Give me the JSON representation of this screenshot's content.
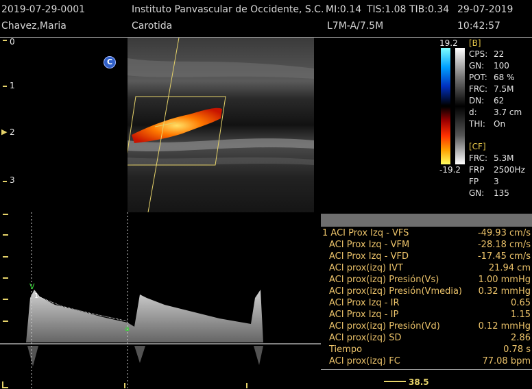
{
  "header": {
    "exam_id": "2019-07-29-0001",
    "patient": "Chavez,Maria",
    "institution": "Instituto Panvascular de Occidente, S.C.",
    "mi": "MI:0.14",
    "tis": "TIS:1.08",
    "tib": "TIB:0.34",
    "date": "29-07-2019",
    "study": "Carotida",
    "probe": "L7M-A/7.5M",
    "time": "10:42:57"
  },
  "depth_scale": [
    "0",
    "1",
    "2",
    "3"
  ],
  "focus_marker": "▶",
  "mode_marker": "C",
  "colorbar": {
    "top_value": "19.2",
    "bottom_value": "-19.2"
  },
  "b_params": {
    "section": "[B]",
    "items": [
      {
        "k": "CPS:",
        "v": "22"
      },
      {
        "k": "GN:",
        "v": "100"
      },
      {
        "k": "POT:",
        "v": "68 %"
      },
      {
        "k": "FRC:",
        "v": "7.5M"
      },
      {
        "k": "DN:",
        "v": "62"
      },
      {
        "k": "d:",
        "v": "3.7 cm"
      },
      {
        "k": "THI:",
        "v": "On"
      }
    ]
  },
  "cf_params": {
    "section": "[CF]",
    "items": [
      {
        "k": "FRC:",
        "v": "5.3M"
      },
      {
        "k": "FRP",
        "v": "2500Hz"
      },
      {
        "k": "FP",
        "v": "3"
      },
      {
        "k": "GN:",
        "v": "135"
      }
    ]
  },
  "measurements": [
    {
      "label": "1 ACI Prox Izq - VFS",
      "value": "-49.93 cm/s"
    },
    {
      "label": "   ACI Prox Izq - VFM",
      "value": "-28.18 cm/s"
    },
    {
      "label": "   ACI Prox Izq - VFD",
      "value": "-17.45 cm/s"
    },
    {
      "label": "   ACI prox(izq) IVT",
      "value": "21.94 cm"
    },
    {
      "label": "   ACI prox(izq) Presión(Vs)",
      "value": "1.00 mmHg"
    },
    {
      "label": "   ACI prox(izq) Presión(Vmedia)",
      "value": "0.32 mmHg"
    },
    {
      "label": "   ACI Prox Izq - IR",
      "value": "0.65"
    },
    {
      "label": "   ACI Prox Izq - IP",
      "value": "1.15"
    },
    {
      "label": "   ACI prox(izq) Presión(Vd)",
      "value": "0.12 mmHg"
    },
    {
      "label": "   ACI prox(izq) SD",
      "value": "2.86"
    },
    {
      "label": "   Tiempo",
      "value": "0.78 s"
    },
    {
      "label": "   ACI prox(izq) FC",
      "value": "77.08 bpm"
    }
  ],
  "doppler_markers": {
    "peak": "V",
    "end": "a",
    "sample": "1"
  },
  "bottom_value": "38.5"
}
